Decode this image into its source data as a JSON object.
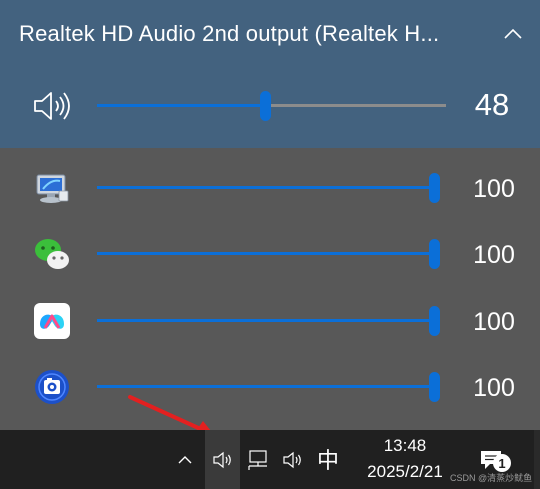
{
  "device": {
    "title": "Realtek HD Audio 2nd output (Realtek H...",
    "master_volume": "48",
    "master_level": 0.48
  },
  "apps": [
    {
      "icon": "computer-icon",
      "volume": "100",
      "level": 1.0
    },
    {
      "icon": "wechat-icon",
      "volume": "100",
      "level": 1.0
    },
    {
      "icon": "baidu-netdisk-icon",
      "volume": "100",
      "level": 1.0
    },
    {
      "icon": "camera-app-icon",
      "volume": "100",
      "level": 1.0
    }
  ],
  "taskbar": {
    "ime": "中",
    "time": "13:48",
    "date": "2025/2/21",
    "notification_count": "1",
    "watermark": "CSDN @清蒸炒鱿鱼"
  },
  "colors": {
    "header_bg": "#43627f",
    "panel_bg": "#585858",
    "accent": "#0b6fd8",
    "taskbar_bg": "#202020",
    "arrow": "#e32020"
  }
}
